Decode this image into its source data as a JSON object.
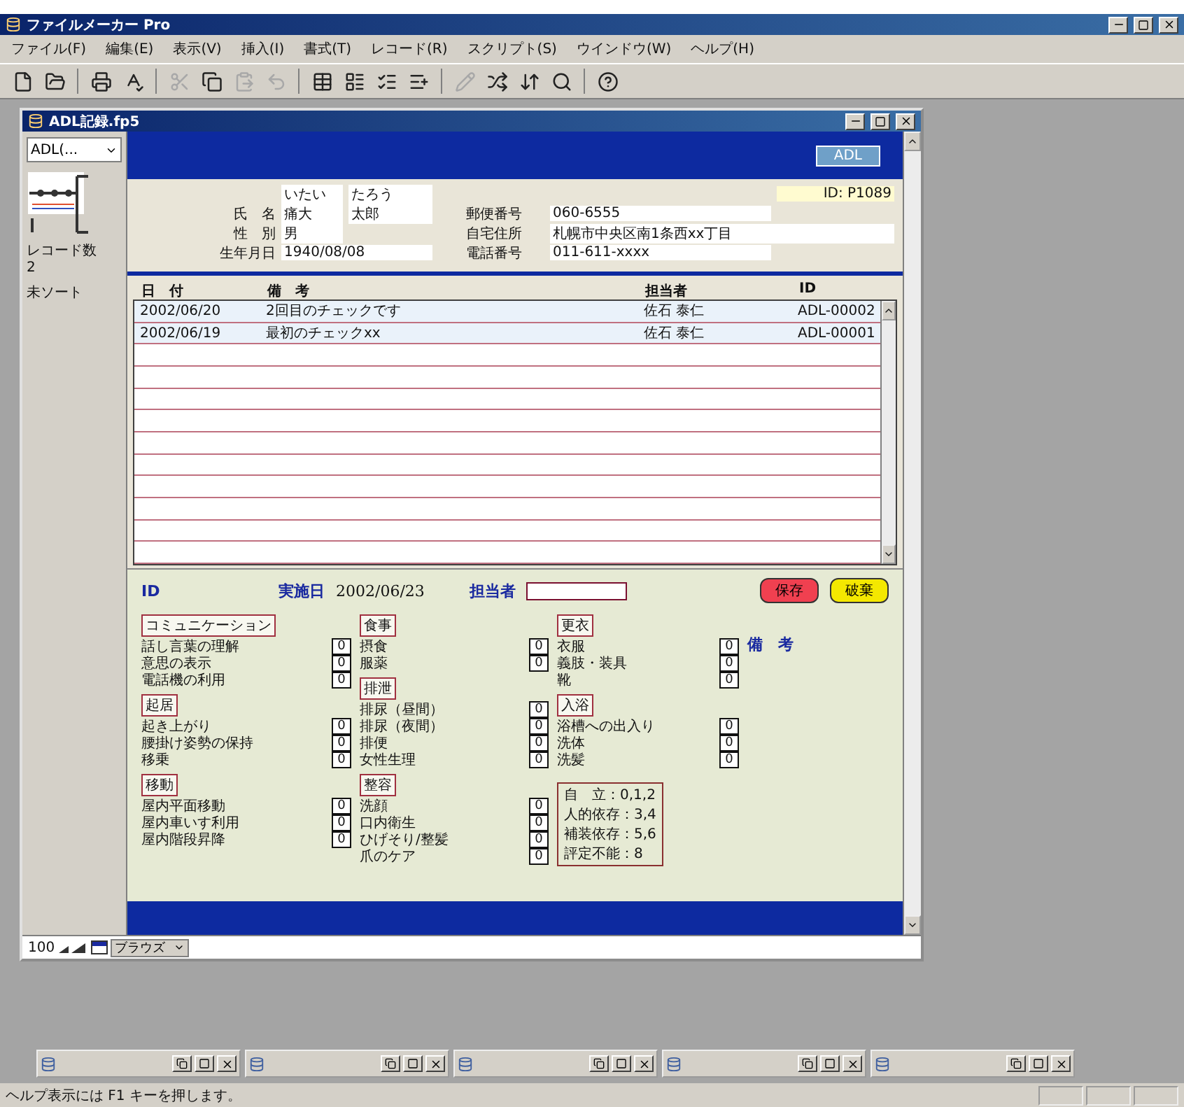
{
  "app": {
    "title": "ファイルメーカー Pro"
  },
  "menu": [
    "ファイル(F)",
    "編集(E)",
    "表示(V)",
    "挿入(I)",
    "書式(T)",
    "レコード(R)",
    "スクリプト(S)",
    "ウインドウ(W)",
    "ヘルプ(H)"
  ],
  "toolbar": [
    {
      "disabled": false
    },
    {
      "disabled": false
    },
    {
      "disabled": false
    },
    {
      "disabled": false
    },
    {
      "disabled": true
    },
    {
      "disabled": false
    },
    {
      "disabled": true
    },
    {
      "disabled": true
    },
    {
      "disabled": false
    },
    {
      "disabled": false
    },
    {
      "disabled": false
    },
    {
      "disabled": false
    },
    {
      "disabled": true
    },
    {
      "disabled": false
    },
    {
      "disabled": false
    },
    {
      "disabled": false
    },
    {
      "disabled": false
    }
  ],
  "window": {
    "title": "ADL記録.fp5"
  },
  "sidebar": {
    "layout": "ADL(...",
    "record_count_label": "レコード数",
    "record_count": "2",
    "sort_status": "未ソート"
  },
  "header": {
    "button": "ADL"
  },
  "patient": {
    "id": "ID: P1089",
    "kana_family": "いたい",
    "kana_given": "たろう",
    "name_label": "氏　名",
    "family_name": "痛大",
    "given_name": "太郎",
    "sex_label": "性　別",
    "sex": "男",
    "birth_label": "生年月日",
    "birth": "1940/08/08",
    "postal_label": "郵便番号",
    "postal": "060-6555",
    "address_label": "自宅住所",
    "address": "札幌市中央区南1条西xx丁目",
    "phone_label": "電話番号",
    "phone": "011-611-xxxx"
  },
  "records": {
    "columns": [
      "日　付",
      "備　考",
      "担当者",
      "ID"
    ],
    "rows": [
      {
        "cells": [
          "2002/06/20",
          "2回目のチェックです",
          "佐石 泰仁",
          "ADL-00002"
        ]
      },
      {
        "cells": [
          "2002/06/19",
          "最初のチェックxx",
          "佐石 泰仁",
          "ADL-00001"
        ]
      }
    ]
  },
  "form": {
    "id_label": "ID",
    "date_label": "実施日",
    "date": "2002/06/23",
    "staff_label": "担当者",
    "buttons": [
      {
        "label": "保存",
        "kind": "save"
      },
      {
        "label": "破棄",
        "kind": "discard"
      }
    ],
    "remarks_label": "備　考",
    "columns": [
      [
        {
          "title": "コミュニケーション",
          "items": [
            {
              "label": "話し言葉の理解",
              "score": "0"
            },
            {
              "label": "意思の表示",
              "score": "0"
            },
            {
              "label": "電話機の利用",
              "score": "0"
            }
          ]
        },
        {
          "title": "起居",
          "items": [
            {
              "label": "起き上がり",
              "score": "0"
            },
            {
              "label": "腰掛け姿勢の保持",
              "score": "0"
            },
            {
              "label": "移乗",
              "score": "0"
            }
          ]
        },
        {
          "title": "移動",
          "items": [
            {
              "label": "屋内平面移動",
              "score": "0"
            },
            {
              "label": "屋内車いす利用",
              "score": "0"
            },
            {
              "label": "屋内階段昇降",
              "score": "0"
            }
          ]
        }
      ],
      [
        {
          "title": "食事",
          "items": [
            {
              "label": "摂食",
              "score": "0"
            },
            {
              "label": "服薬",
              "score": "0"
            }
          ]
        },
        {
          "title": "排泄",
          "items": [
            {
              "label": "排尿（昼間）",
              "score": "0"
            },
            {
              "label": "排尿（夜間）",
              "score": "0"
            },
            {
              "label": "排便",
              "score": "0"
            },
            {
              "label": "女性生理",
              "score": "0"
            }
          ]
        },
        {
          "title": "整容",
          "items": [
            {
              "label": "洗顔",
              "score": "0"
            },
            {
              "label": "口内衛生",
              "score": "0"
            },
            {
              "label": "ひげそり/整髪",
              "score": "0"
            },
            {
              "label": "爪のケア",
              "score": "0"
            }
          ]
        }
      ],
      [
        {
          "title": "更衣",
          "items": [
            {
              "label": "衣服",
              "score": "0"
            },
            {
              "label": "義肢・装具",
              "score": "0"
            },
            {
              "label": "靴",
              "score": "0"
            }
          ]
        },
        {
          "title": "入浴",
          "items": [
            {
              "label": "浴槽への出入り",
              "score": "0"
            },
            {
              "label": "洗体",
              "score": "0"
            },
            {
              "label": "洗髪",
              "score": "0"
            }
          ]
        }
      ]
    ],
    "legend": [
      "自　立：0,1,2",
      "人的依存：3,4",
      "補装依存：5,6",
      "評定不能：8"
    ]
  },
  "zoom": "100",
  "mode": "ブラウズ",
  "minimized_windows": [
    {
      "kind": "window"
    },
    {
      "kind": "window"
    },
    {
      "kind": "window"
    },
    {
      "kind": "window"
    },
    {
      "kind": "window"
    }
  ],
  "status_bar": "ヘルプ表示には F1 キーを押します。"
}
